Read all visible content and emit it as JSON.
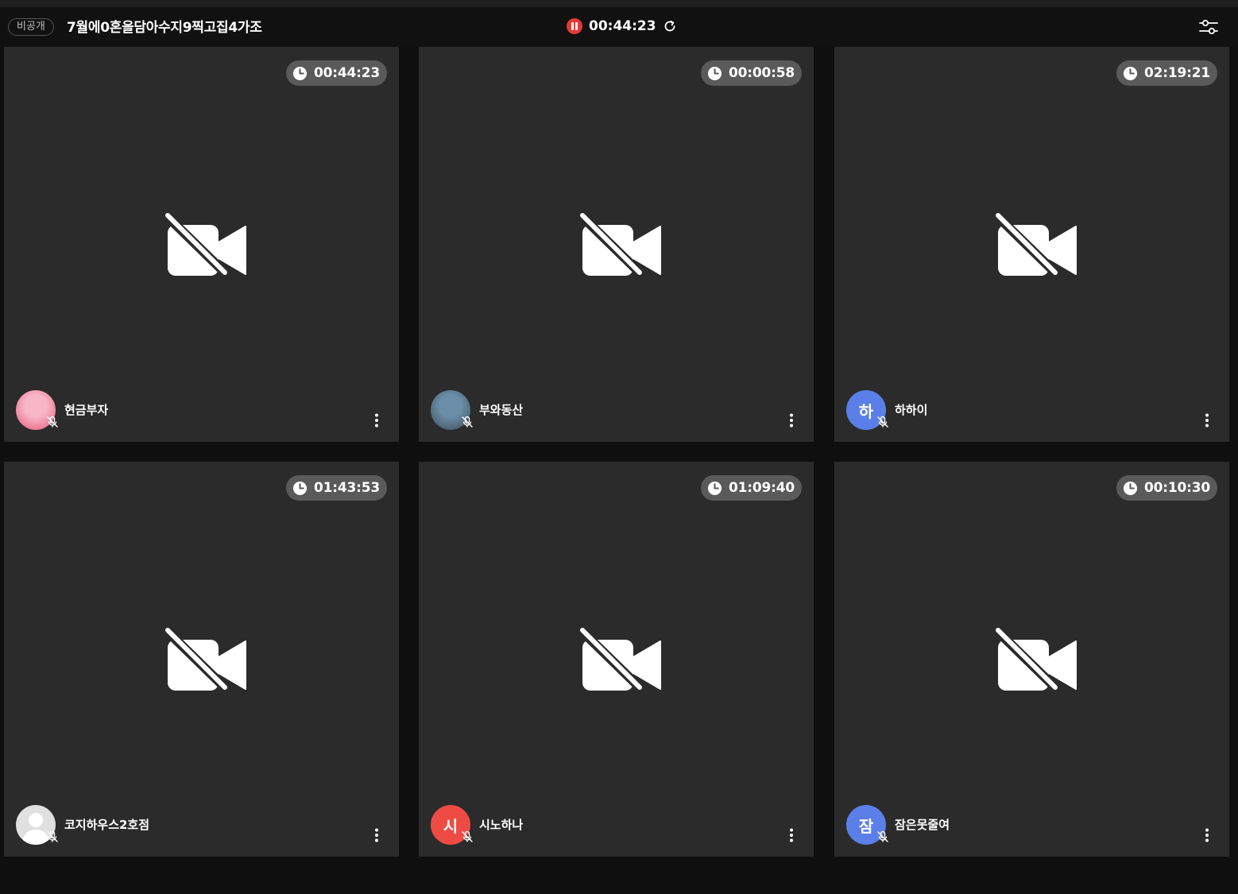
{
  "header": {
    "badge": "비공개",
    "room_title": "7월에0혼을담아수지9찍고집4가조",
    "record_time": "00:44:23"
  },
  "tiles": [
    {
      "name": "현금부자",
      "timer": "00:44:23",
      "avatar_type": "image",
      "avatar_colors": [
        "#f7b7c7",
        "#e8567a"
      ]
    },
    {
      "name": "부와동산",
      "timer": "00:00:58",
      "avatar_type": "image",
      "avatar_colors": [
        "#6b8fa8",
        "#3c4a55"
      ]
    },
    {
      "name": "하하이",
      "timer": "02:19:21",
      "avatar_type": "letter",
      "avatar_letter": "하",
      "avatar_color": "#5b7fe8"
    },
    {
      "name": "코지하우스2호점",
      "timer": "01:43:53",
      "avatar_type": "default",
      "avatar_color": "#e0e0e0"
    },
    {
      "name": "시노하나",
      "timer": "01:09:40",
      "avatar_type": "letter",
      "avatar_letter": "시",
      "avatar_color": "#ef4b45"
    },
    {
      "name": "잠은못줄여",
      "timer": "00:10:30",
      "avatar_type": "letter",
      "avatar_letter": "잠",
      "avatar_color": "#5b7fe8"
    }
  ],
  "icons": {
    "record": "pause-recording-icon",
    "refresh": "refresh-icon",
    "settings": "sliders-settings-icon",
    "tile_timer": "clock-icon",
    "camera": "camera-off-icon",
    "mic": "mic-off-icon",
    "menu": "more-vertical-icon"
  },
  "colors": {
    "background": "#0f0f0f",
    "tile": "#2b2b2b",
    "timer_pill": "#5a5a5a",
    "record": "#e53935"
  }
}
